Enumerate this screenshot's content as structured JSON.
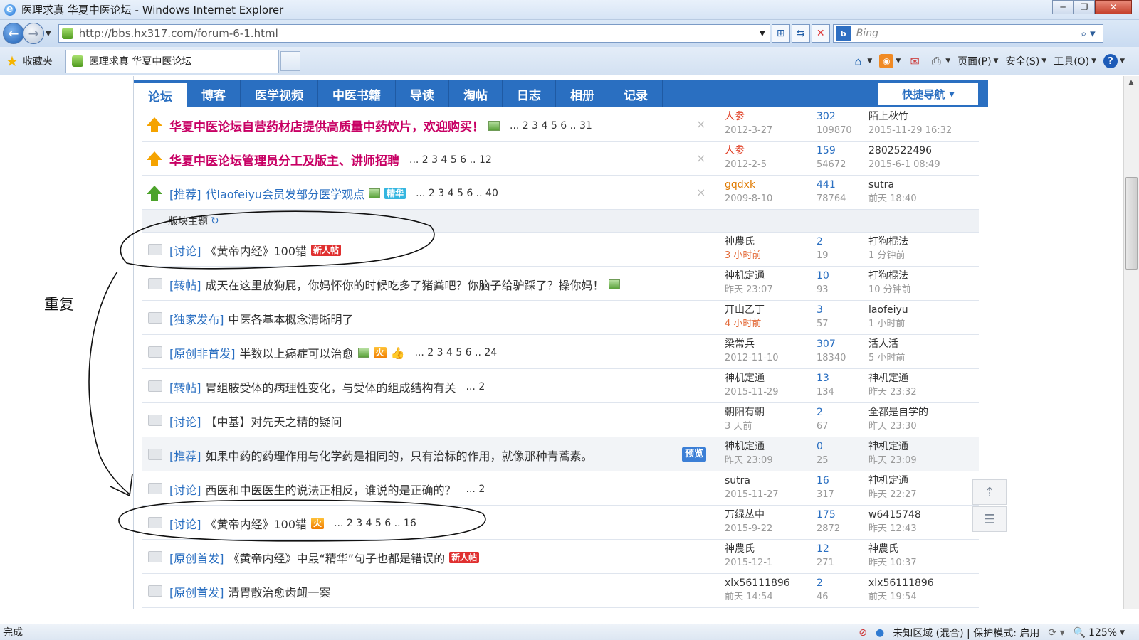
{
  "window": {
    "title": "医理求真 华夏中医论坛 - Windows Internet Explorer",
    "minimize": "─",
    "maximize": "❐",
    "close": "✕"
  },
  "address": {
    "url": "http://bbs.hx317.com/forum-6-1.html",
    "search_placeholder": "Bing"
  },
  "favorites": {
    "label": "收藏夹",
    "tab_title": "医理求真 华夏中医论坛"
  },
  "commands": {
    "page": "页面(P)",
    "safety": "安全(S)",
    "tools": "工具(O)"
  },
  "forum_nav": {
    "items": [
      "论坛",
      "博客",
      "医学视频",
      "中医书籍",
      "导读",
      "淘帖",
      "日志",
      "相册",
      "记录"
    ],
    "quick_nav": "快捷导航"
  },
  "sticky_threads": [
    {
      "title": "华夏中医论坛自营药材店提供高质量中药饮片，欢迎购买！",
      "pages": "... 2 3 4 5 6 .. 31",
      "author": "人参",
      "date": "2012-3-27",
      "replies": "302",
      "views": "109870",
      "last_user": "陌上秋竹",
      "last_time": "2015-11-29 16:32"
    },
    {
      "title": "华夏中医论坛管理员分工及版主、讲师招聘",
      "pages": "... 2 3 4 5 6 .. 12",
      "author": "人参",
      "date": "2012-2-5",
      "replies": "159",
      "views": "54672",
      "last_user": "2802522496",
      "last_time": "2015-6-1 08:49"
    },
    {
      "category": "[推荐]",
      "title": "代laofeiyu会员发部分医学观点",
      "badge": "精华",
      "pages": "... 2 3 4 5 6 .. 40",
      "author": "gqdxk",
      "date": "2009-8-10",
      "replies": "441",
      "views": "78764",
      "last_user": "sutra",
      "last_time": "前天 18:40"
    }
  ],
  "section_label": "版块主题",
  "threads": [
    {
      "category": "[讨论]",
      "title": "《黄帝内经》100错",
      "badge": "新人帖",
      "author": "神農氏",
      "date": "3 小时前",
      "replies": "2",
      "views": "19",
      "last_user": "打狗棍法",
      "last_time": "1 分钟前"
    },
    {
      "category": "[转帖]",
      "title": "成天在这里放狗屁，你妈怀你的时候吃多了猪粪吧？你脑子给驴踩了？操你妈！",
      "author": "神机定通",
      "date": "昨天 23:07",
      "replies": "10",
      "views": "93",
      "last_user": "打狗棍法",
      "last_time": "10 分钟前"
    },
    {
      "category": "[独家发布]",
      "title": "中医各基本概念清晰明了",
      "author": "丌山乙丁",
      "date": "4 小时前",
      "replies": "3",
      "views": "57",
      "last_user": "laofeiyu",
      "last_time": "1 小时前"
    },
    {
      "category": "[原创非首发]",
      "title": "半数以上癌症可以治愈",
      "badge": "火",
      "pages": "... 2 3 4 5 6 .. 24",
      "author": "梁常兵",
      "date": "2012-11-10",
      "replies": "307",
      "views": "18340",
      "last_user": "活人活",
      "last_time": "5 小时前"
    },
    {
      "category": "[转帖]",
      "title": "胃组胺受体的病理性变化，与受体的组成结构有关",
      "pages": "... 2",
      "author": "神机定通",
      "date": "2015-11-29",
      "replies": "13",
      "views": "134",
      "last_user": "神机定通",
      "last_time": "昨天 23:32"
    },
    {
      "category": "[讨论]",
      "title": "【中基】对先天之精的疑问",
      "author": "朝阳有朝",
      "date": "3 天前",
      "replies": "2",
      "views": "67",
      "last_user": "全都是自学的",
      "last_time": "昨天 23:30"
    },
    {
      "category": "[推荐]",
      "title": "如果中药的药理作用与化学药是相同的，只有治标的作用，就像那种青蒿素。",
      "badge": "预览",
      "author": "神机定通",
      "date": "昨天 23:09",
      "replies": "0",
      "views": "25",
      "last_user": "神机定通",
      "last_time": "昨天 23:09"
    },
    {
      "category": "[讨论]",
      "title": "西医和中医医生的说法正相反，谁说的是正确的？",
      "pages": "... 2",
      "author": "sutra",
      "date": "2015-11-27",
      "replies": "16",
      "views": "317",
      "last_user": "神机定通",
      "last_time": "昨天 22:27"
    },
    {
      "category": "[讨论]",
      "title": "《黄帝内经》100错",
      "badge": "火",
      "pages": "... 2 3 4 5 6 .. 16",
      "author": "万绿丛中",
      "date": "2015-9-22",
      "replies": "175",
      "views": "2872",
      "last_user": "w6415748",
      "last_time": "昨天 12:43"
    },
    {
      "category": "[原创首发]",
      "title": "《黄帝内经》中最“精华”句子也都是错误的",
      "badge": "新人帖",
      "author": "神農氏",
      "date": "2015-12-1",
      "replies": "12",
      "views": "271",
      "last_user": "神農氏",
      "last_time": "昨天 10:37"
    },
    {
      "category": "[原创首发]",
      "title": "清胃散治愈齿衄一案",
      "author": "xlx56111896",
      "date": "前天 14:54",
      "replies": "2",
      "views": "46",
      "last_user": "xlx56111896",
      "last_time": "前天 19:54"
    }
  ],
  "annotation": {
    "label": "重复"
  },
  "status": {
    "done": "完成",
    "zone": "未知区域 (混合) | 保护模式: 启用",
    "zoom": "125%"
  }
}
